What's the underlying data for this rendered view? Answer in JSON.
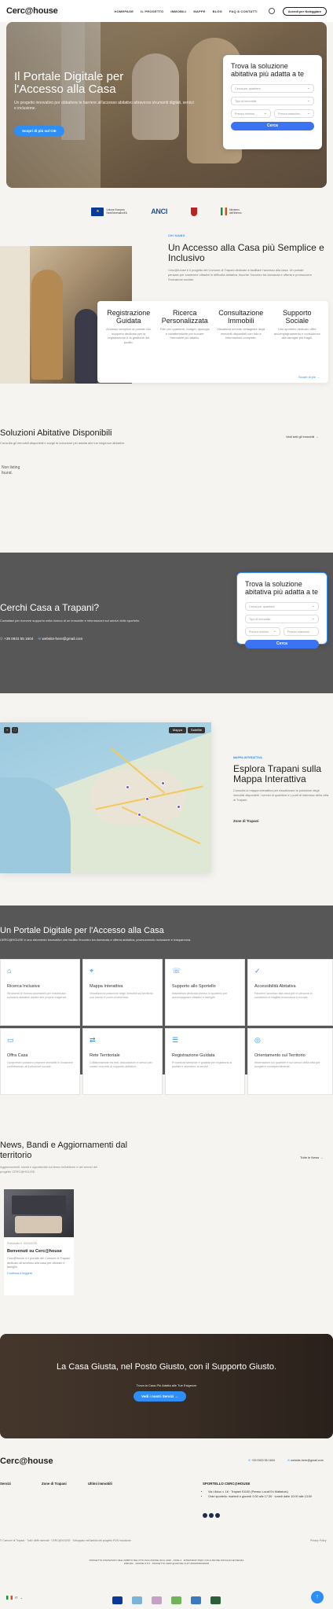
{
  "header": {
    "logo": "Cerc@house",
    "nav": [
      "HOMEPAGE",
      "IL PROGETTO",
      "IMMOBILI",
      "MAPPE",
      "BLOG",
      "FAQ & CONTATTI"
    ],
    "login_label": "Accedi per Noleggiare"
  },
  "hero": {
    "title": "Il Portale Digitale per l'Accesso alla Casa",
    "subtitle": "Un progetto innovativo per abbattere le barriere all'accesso abitativo attraverso strumenti digitali, servizi e inclusione.",
    "cta": "Scopri di più sul CIE"
  },
  "search_form": {
    "title": "Trova la soluzione abitativa più adatta a te",
    "field_location": "Cerca per quartiere",
    "field_type": "Tipo di immobile",
    "field_min": "Prezzo minimo",
    "field_max": "Prezzo massimo",
    "submit": "Cerca"
  },
  "partners": [
    {
      "name": "Unione Europea",
      "line2": "NextGenerationEU"
    },
    {
      "name": "ANCI",
      "line2": ""
    },
    {
      "name": "Comune di Trapani",
      "line2": ""
    },
    {
      "name": "Ministero",
      "line2": "dell'Interno"
    }
  ],
  "about": {
    "kicker": "CHI SIAMO",
    "title": "Un Accesso alla Casa più Semplice e Inclusivo",
    "description": "Cerc@house è il progetto del Comune di Trapani dedicato a facilitare l'accesso alla casa. Un portale pensato per sostenere cittadini in difficoltà abitativa, favorire l'incontro tra domanda e offerta e promuovere l'inclusione sociale.",
    "services": [
      {
        "title": "Registrazione Guidata",
        "text": "Accesso semplice al portale con supporto dedicato per la registrazione e la gestione del profilo."
      },
      {
        "title": "Ricerca Personalizzata",
        "text": "Filtri per quartiere, budget, tipologia e caratteristiche per trovare l'immobile più adatto."
      },
      {
        "title": "Consultazione Immobili",
        "text": "Visualizza schede dettagliate degli immobili disponibili con foto e informazioni complete."
      },
      {
        "title": "Supporto Sociale",
        "text": "Uno sportello dedicato offre accompagnamento e consulenza alle famiglie più fragili."
      }
    ],
    "link": "Scopri di più"
  },
  "solutions": {
    "title": "Soluzioni Abitative Disponibili",
    "subtitle": "Consulta gli immobili disponibili e scegli la soluzione più adatta alle tue esigenze abitative.",
    "link": "Vedi tutti gli immobili",
    "empty": "Non listing found."
  },
  "contact": {
    "title": "Cerchi Casa a Trapani?",
    "description": "Contattaci per ricevere supporto nella ricerca di un immobile e informazioni sui servizi dello sportello.",
    "phone": "+39 0923 55 1604",
    "email": "website-here@gmail.com"
  },
  "map": {
    "kicker": "MAPPA INTERATTIVA",
    "title": "Esplora Trapani sulla Mappa Interattiva",
    "description": "Consulta la mappa interattiva per visualizzare la posizione degli immobili disponibili, i servizi di quartiere e i punti di interesse della città di Trapani.",
    "area": "Zone di Trapani",
    "controls": [
      "Mappa",
      "Satellite"
    ]
  },
  "portal": {
    "title": "Un Portale Digitale per l'Accesso alla Casa",
    "description": "CERC@HOUSE è uno strumento innovativo che facilita l'incontro tra domanda e offerta abitativa, promuovendo inclusione e trasparenza.",
    "cards": [
      {
        "icon": "⌂",
        "title": "Ricerca Inclusiva",
        "text": "Strumenti di ricerca accessibili per individuare soluzioni abitative adatte alle proprie esigenze."
      },
      {
        "icon": "⌖",
        "title": "Mappa Interattiva",
        "text": "Visualizza la posizione degli immobili sul territorio con servizi e punti di interesse."
      },
      {
        "icon": "☏",
        "title": "Supporto allo Sportello",
        "text": "Assistenza dedicata presso lo sportello per accompagnare cittadini e famiglie."
      },
      {
        "icon": "✓",
        "title": "Accessibilità Abitativa",
        "text": "Favorire l'accesso alla casa per le persone in condizioni di fragilità economica e sociale."
      },
      {
        "icon": "▭",
        "title": "Offra Casa",
        "text": "I proprietari possono proporre immobili in locazione contribuendo all'inclusione sociale."
      },
      {
        "icon": "⇄",
        "title": "Rete Territoriale",
        "text": "Collaborazione tra enti, associazioni e servizi per creare una rete di supporto abitativo."
      },
      {
        "icon": "☰",
        "title": "Registrazione Guidata",
        "text": "Procedura semplice e guidata per registrarsi al portale e accedere ai servizi."
      },
      {
        "icon": "◎",
        "title": "Orientamento sul Territorio",
        "text": "Informazioni sui quartieri e sui servizi della città per scegliere consapevolmente."
      }
    ]
  },
  "news": {
    "title": "News, Bandi e Aggiornamenti dal territorio",
    "description": "Aggiornamenti, bandi e opportunità sul tema dell'abitare e dei servizi del progetto CERC@HOUSE.",
    "link": "Tutte le News",
    "card": {
      "meta": "Pubblicato il: 03/04/2025",
      "title": "Benvenuti su Cerc@house",
      "text": "Cerc@house è il portale del Comune di Trapani dedicato all'accesso alla casa per cittadini e famiglie.",
      "more": "Continua a leggere"
    }
  },
  "cta": {
    "title": "La Casa Giusta, nel Posto Giusto, con il Supporto Giusto.",
    "subtitle": "Trova la Casa Più Adatta alle Tue Esigenze",
    "button": "Vedi i nostri Servizi"
  },
  "footer": {
    "logo": "Cerc@house",
    "phone": "+39 0923 55 1604",
    "email": "website-here@gmail.com",
    "col1": "Servizi",
    "col2": "Zone di Trapani",
    "col3": "Ultimi immobili",
    "office_title": "SPORTELLO CERC@HOUSE",
    "office_lines": [
      "Via Libica n. 16 · Trapani 91100 (Presso Locali Ex Mattatoio)",
      "Orari sportello: martedì e giovedì 9:30 alle 17:30 · lunedì dalle 10:00 alle 13:00"
    ],
    "copyright": "© Comune di Trapani · Tutti i diritti riservati · CERC@HOUSE · Sviluppato nell'ambito del progetto PON Inclusione",
    "privacy": "Privacy Policy",
    "funding": "PROGETTO FINANZIATO NELL'AMBITO DEL PON INCLUSIONE 2014–2020 · ASSE 4 · INTERVENTI PER L'INCLUSIONE SOCIALE DEI SENZA DIMORA · AZIONE 9.5.9 · PROGETTO CERC@HOUSE CUP C99I23000000006",
    "language": "IT",
    "bottom_logos": [
      "Unione Europea",
      "Regione",
      "Comune",
      "Inclusione",
      "Sportello",
      "Ministero"
    ]
  },
  "colors": {
    "accent": "#2e8ef5",
    "dark": "#575757"
  }
}
